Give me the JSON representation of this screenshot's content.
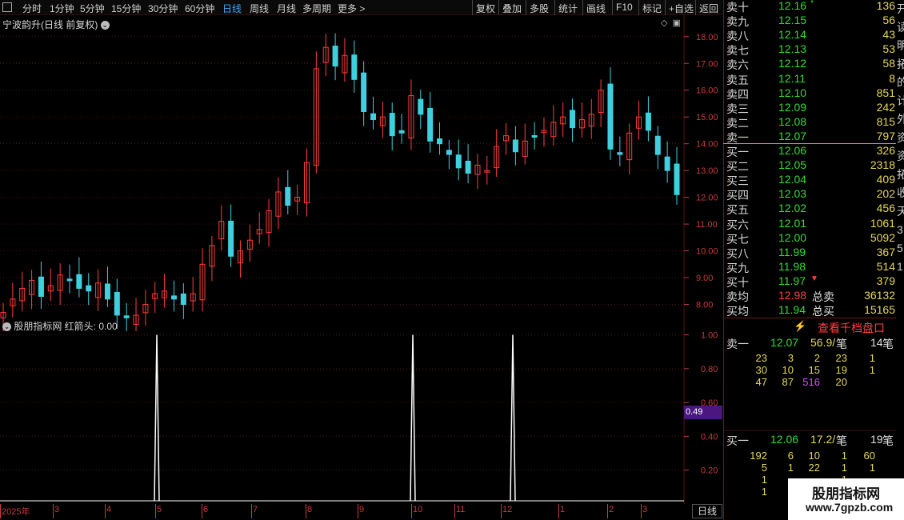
{
  "toolbar": {
    "periods": [
      "分时",
      "1分钟",
      "5分钟",
      "15分钟",
      "30分钟",
      "60分钟",
      "日线",
      "周线",
      "月线",
      "多周期",
      "更多 >"
    ],
    "active": "日线",
    "tools": [
      "复权",
      "叠加",
      "多股",
      "统计",
      "画线",
      "F10",
      "标记",
      "+自选",
      "返回"
    ]
  },
  "stock": {
    "title": "宁波韵升(日线 前复权)"
  },
  "price_axis": [
    "18.00",
    "17.00",
    "16.00",
    "15.00",
    "14.00",
    "13.00",
    "12.00",
    "11.00",
    "10.00",
    "9.00",
    "8.00"
  ],
  "indicator": {
    "title": "股朋指标网 红箭头: 0.00",
    "axis": [
      "1.00",
      "0.80",
      "0.60",
      "0.40",
      "0.20"
    ],
    "current": "0.49"
  },
  "xaxis": [
    "2025年",
    "3",
    "4",
    "5",
    "6",
    "7",
    "8",
    "9",
    "10",
    "11",
    "12",
    "1",
    "2",
    "3"
  ],
  "period_label": "日线",
  "sell": [
    {
      "label": "卖十",
      "price": "12.16",
      "vol": "136",
      "flag": "*"
    },
    {
      "label": "卖九",
      "price": "12.15",
      "vol": "56"
    },
    {
      "label": "卖八",
      "price": "12.14",
      "vol": "43"
    },
    {
      "label": "卖七",
      "price": "12.13",
      "vol": "53"
    },
    {
      "label": "卖六",
      "price": "12.12",
      "vol": "58"
    },
    {
      "label": "卖五",
      "price": "12.11",
      "vol": "8"
    },
    {
      "label": "卖四",
      "price": "12.10",
      "vol": "851"
    },
    {
      "label": "卖三",
      "price": "12.09",
      "vol": "242"
    },
    {
      "label": "卖二",
      "price": "12.08",
      "vol": "815"
    },
    {
      "label": "卖一",
      "price": "12.07",
      "vol": "797"
    }
  ],
  "buy": [
    {
      "label": "买一",
      "price": "12.06",
      "vol": "326"
    },
    {
      "label": "买二",
      "price": "12.05",
      "vol": "2318"
    },
    {
      "label": "买三",
      "price": "12.04",
      "vol": "409"
    },
    {
      "label": "买四",
      "price": "12.03",
      "vol": "202"
    },
    {
      "label": "买五",
      "price": "12.02",
      "vol": "456"
    },
    {
      "label": "买六",
      "price": "12.01",
      "vol": "1061"
    },
    {
      "label": "买七",
      "price": "12.00",
      "vol": "5092"
    },
    {
      "label": "买八",
      "price": "11.99",
      "vol": "367"
    },
    {
      "label": "买九",
      "price": "11.98",
      "vol": "514"
    },
    {
      "label": "买十",
      "price": "11.97",
      "vol": "379",
      "flag": "▼"
    }
  ],
  "avg": {
    "sell_label": "卖均",
    "sell_price": "12.98",
    "sell_total_label": "总卖",
    "sell_total": "36132",
    "buy_label": "买均",
    "buy_price": "11.94",
    "buy_total_label": "总买",
    "buy_total": "15165"
  },
  "qianpan": "查看千档盘口",
  "ask1": {
    "label": "卖一",
    "price": "12.07",
    "avg": "56.9/",
    "unit": "笔",
    "count": "14",
    "count_unit": "笔"
  },
  "ask_rows": [
    [
      "23",
      "3",
      "2",
      "23",
      "1"
    ],
    [
      "30",
      "10",
      "15",
      "19",
      "1"
    ],
    [
      "47",
      "87",
      "516",
      "20",
      ""
    ]
  ],
  "bid1": {
    "label": "买一",
    "price": "12.06",
    "avg": "17.2/",
    "unit": "笔",
    "count": "19",
    "count_unit": "笔"
  },
  "bid_rows": [
    [
      "192",
      "6",
      "10",
      "1",
      "60"
    ],
    [
      "5",
      "1",
      "22",
      "1",
      "1"
    ],
    [
      "1",
      "",
      "",
      "1",
      ""
    ],
    [
      "1",
      "",
      "",
      "",
      ""
    ]
  ],
  "far_chars": [
    "开",
    "读",
    "明",
    "拓",
    "的",
    "计",
    "外",
    "资",
    "资",
    "拓",
    "收",
    "天",
    "3",
    "5",
    "1"
  ],
  "watermark": {
    "line1": "股朋指标网",
    "line2": "www.7gpzb.com"
  },
  "colors": {
    "up": "#ff3c3c",
    "down": "#3fd0e0",
    "grid": "#5a1010",
    "axis": "#c43c3c",
    "panel_border": "#6a1a1a"
  },
  "chart_data": [
    {
      "type": "candlestick",
      "title": "宁波韵升(日线 前复权)",
      "ylim": [
        7.0,
        18.8
      ],
      "x_range": [
        "2025-02",
        "2026-03"
      ],
      "close_series": [
        7.7,
        8.2,
        8.6,
        8.9,
        8.3,
        8.7,
        9.1,
        8.9,
        8.6,
        8.5,
        8.8,
        8.2,
        7.6,
        7.5,
        7.6,
        8.0,
        8.4,
        8.5,
        8.2,
        8.0,
        8.4,
        9.5,
        10.2,
        11.1,
        9.8,
        10.0,
        10.4,
        10.8,
        11.5,
        12.2,
        11.7,
        12.0,
        13.3,
        16.8,
        17.6,
        16.9,
        17.3,
        16.4,
        15.2,
        14.9,
        15.0,
        14.3,
        14.4,
        15.8,
        15.1,
        14.1,
        14.0,
        13.6,
        13.1,
        12.9,
        13.2,
        13.0,
        13.9,
        14.3,
        13.7,
        14.1,
        14.3,
        14.5,
        14.8,
        15.0,
        14.6,
        14.9,
        15.1,
        16.0,
        13.8,
        13.6,
        14.4,
        15.0,
        14.5,
        13.6,
        13.0,
        12.1
      ]
    },
    {
      "type": "line",
      "title": "股朋指标网 红箭头: 0.00",
      "ylim": [
        0,
        1.05
      ],
      "spikes": [
        {
          "x": "5",
          "value": 1.0
        },
        {
          "x": "10",
          "value": 1.0
        },
        {
          "x": "12",
          "value": 1.0
        }
      ]
    }
  ]
}
